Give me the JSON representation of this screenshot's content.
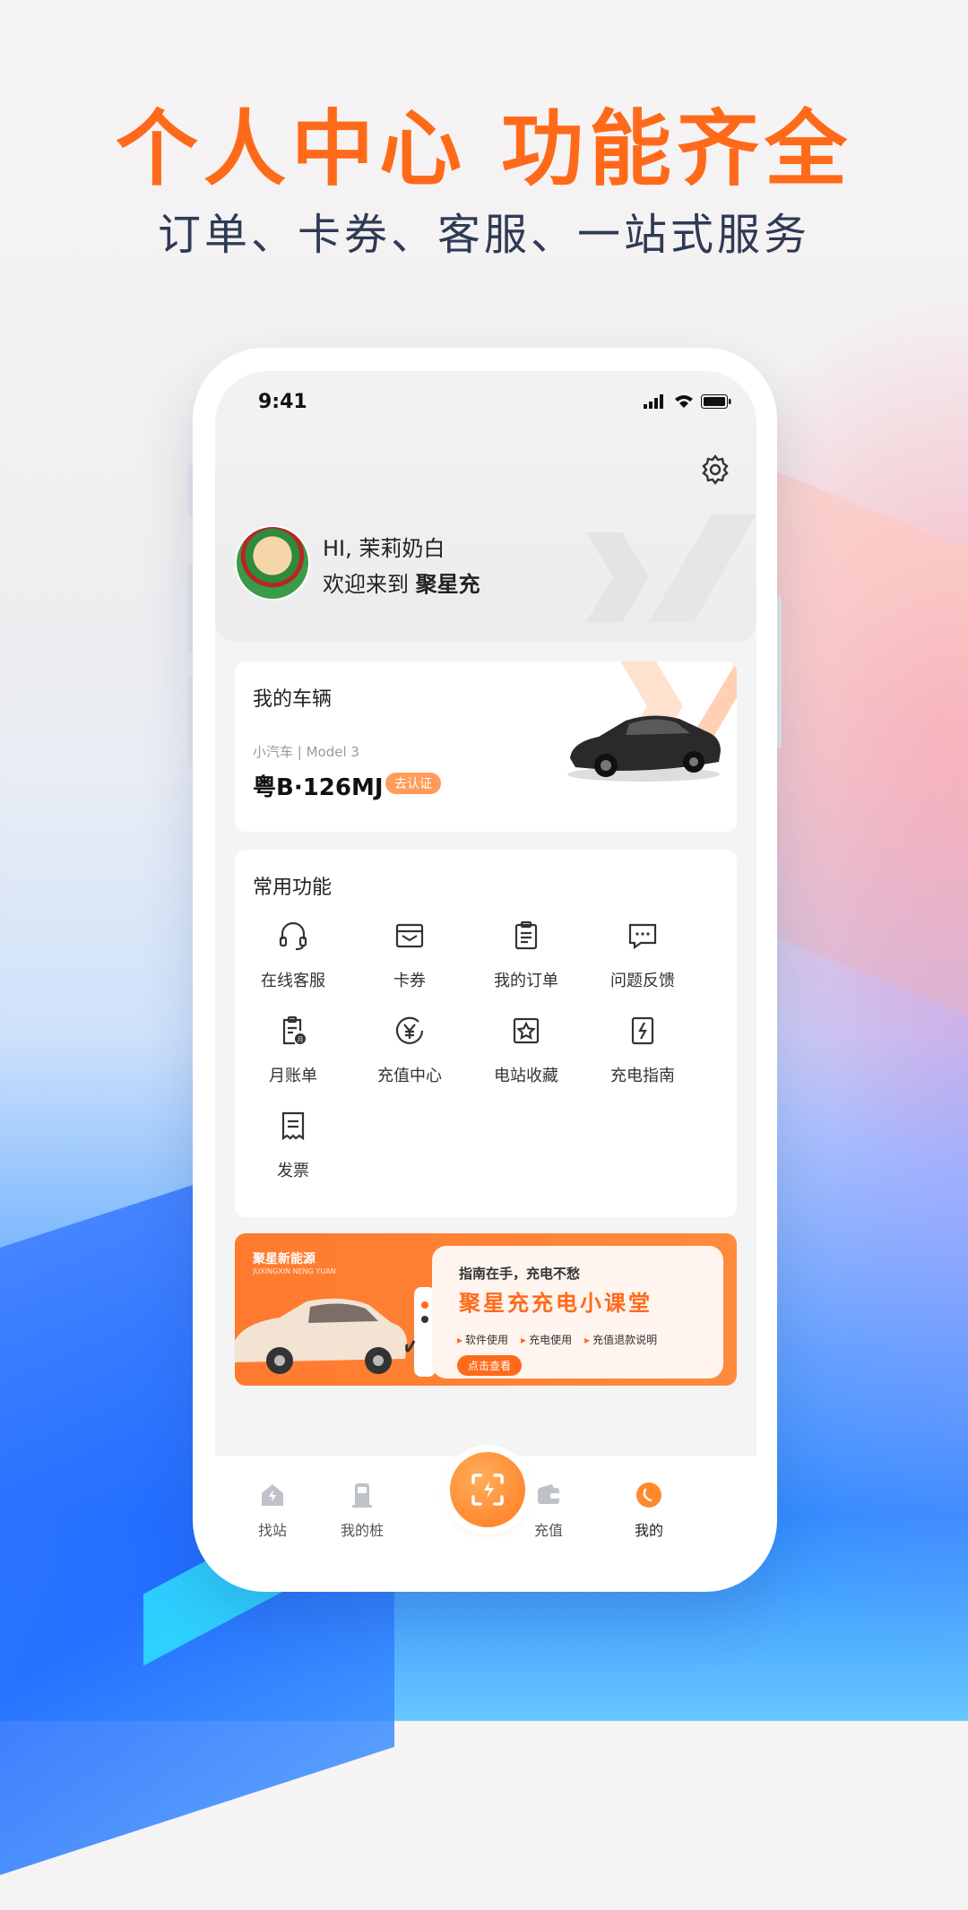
{
  "promo": {
    "headline": "个人中心  功能齐全",
    "subline": "订单、卡券、客服、一站式服务"
  },
  "status_bar": {
    "time": "9:41"
  },
  "profile": {
    "greeting": "HI, 茉莉奶白",
    "welcome_prefix": "欢迎来到",
    "brand_name": "聚星充"
  },
  "vehicle": {
    "title": "我的车辆",
    "subtitle": "小汽车 | Model 3",
    "plate": "粤B·126MJ",
    "verify_label": "去认证"
  },
  "functions": {
    "title": "常用功能",
    "items": [
      {
        "label": "在线客服",
        "icon": "headset-icon"
      },
      {
        "label": "卡券",
        "icon": "coupon-icon"
      },
      {
        "label": "我的订单",
        "icon": "clipboard-icon"
      },
      {
        "label": "问题反馈",
        "icon": "chat-bubble-icon"
      },
      {
        "label": "月账单",
        "icon": "monthly-bill-icon"
      },
      {
        "label": "充值中心",
        "icon": "yuan-coin-icon"
      },
      {
        "label": "电站收藏",
        "icon": "star-box-icon"
      },
      {
        "label": "充电指南",
        "icon": "lightning-book-icon"
      },
      {
        "label": "发票",
        "icon": "receipt-icon"
      }
    ]
  },
  "banner": {
    "brand": "聚星新能源",
    "brand_en": "JUXINGXIN NENG YUAN",
    "tagline": "指南在手，充电不愁",
    "title": "聚星充充电小课堂",
    "tags": [
      "软件使用",
      "充电使用",
      "充值退款说明"
    ],
    "button": "点击查看"
  },
  "tabbar": {
    "tabs": [
      {
        "label": "找站",
        "icon": "station-home-icon"
      },
      {
        "label": "我的桩",
        "icon": "charger-pile-icon"
      },
      {
        "label": "",
        "icon": "scan-icon"
      },
      {
        "label": "充值",
        "icon": "wallet-icon"
      },
      {
        "label": "我的",
        "icon": "profile-icon"
      }
    ]
  },
  "colors": {
    "accent": "#ff6a1a",
    "headline": "#ff6a1a",
    "subline": "#2e3a55"
  }
}
